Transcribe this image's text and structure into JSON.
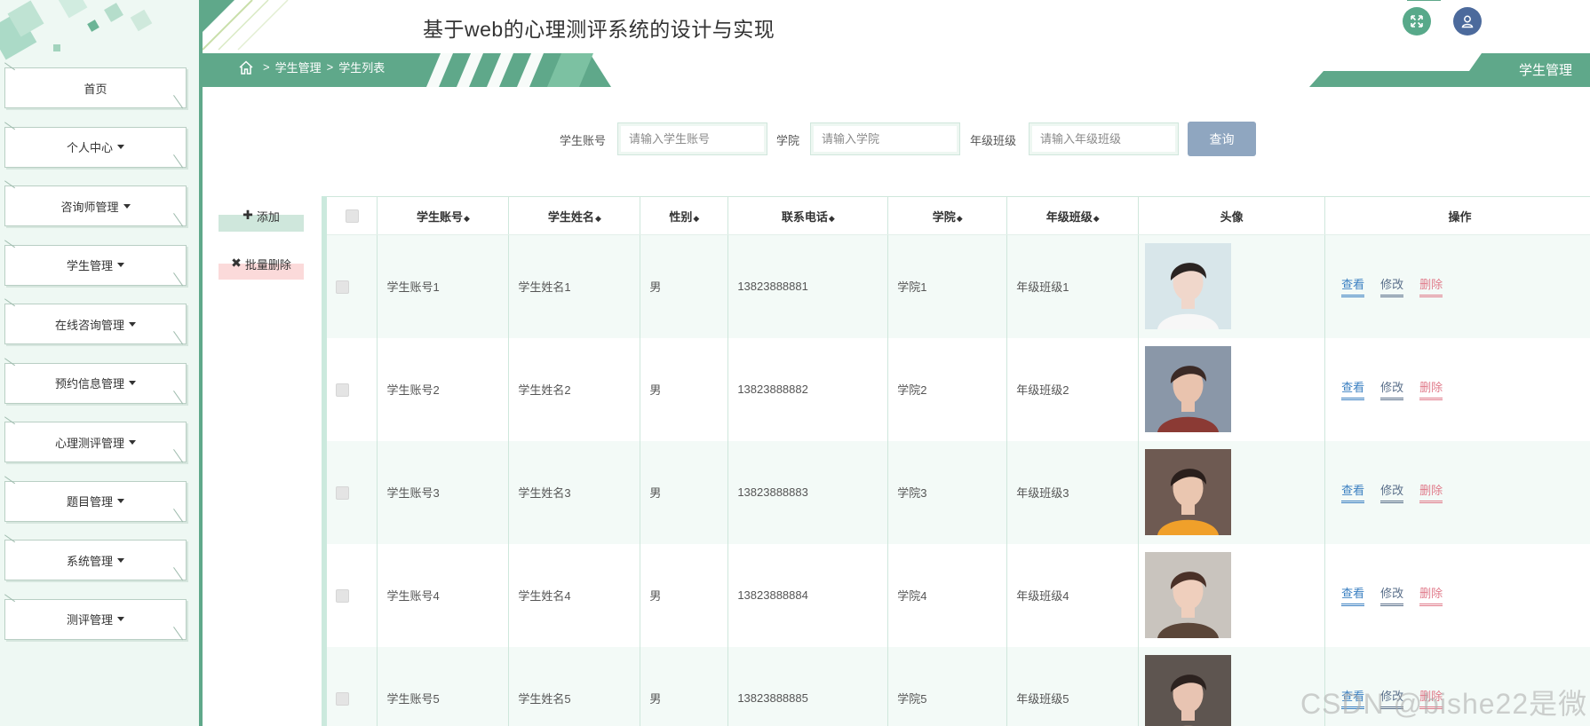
{
  "app": {
    "title": "基于web的心理测评系统的设计与实现"
  },
  "header": {
    "breadcrumb": [
      "学生管理",
      "学生列表"
    ],
    "page_tag": "学生管理",
    "icons": {
      "fullscreen": "fullscreen-icon",
      "user": "user-icon",
      "home": "home-icon"
    }
  },
  "sidebar": {
    "items": [
      {
        "label": "首页",
        "caret": false
      },
      {
        "label": "个人中心",
        "caret": true
      },
      {
        "label": "咨询师管理",
        "caret": true
      },
      {
        "label": "学生管理",
        "caret": true
      },
      {
        "label": "在线咨询管理",
        "caret": true
      },
      {
        "label": "预约信息管理",
        "caret": true
      },
      {
        "label": "心理测评管理",
        "caret": true
      },
      {
        "label": "题目管理",
        "caret": true
      },
      {
        "label": "系统管理",
        "caret": true
      },
      {
        "label": "测评管理",
        "caret": true
      }
    ]
  },
  "search": {
    "account_label": "学生账号",
    "account_placeholder": "请输入学生账号",
    "college_label": "学院",
    "college_placeholder": "请输入学院",
    "class_label": "年级班级",
    "class_placeholder": "请输入年级班级",
    "query_button": "查询"
  },
  "actions": {
    "add": "添加",
    "batch_delete": "批量删除"
  },
  "table": {
    "headers": [
      "学生账号",
      "学生姓名",
      "性别",
      "联系电话",
      "学院",
      "年级班级",
      "头像",
      "操作"
    ],
    "sortable": [
      true,
      true,
      true,
      true,
      true,
      true,
      false,
      false
    ],
    "rows": [
      {
        "account": "学生账号1",
        "name": "学生姓名1",
        "gender": "男",
        "phone": "13823888881",
        "college": "学院1",
        "class": "年级班级1"
      },
      {
        "account": "学生账号2",
        "name": "学生姓名2",
        "gender": "男",
        "phone": "13823888882",
        "college": "学院2",
        "class": "年级班级2"
      },
      {
        "account": "学生账号3",
        "name": "学生姓名3",
        "gender": "男",
        "phone": "13823888883",
        "college": "学院3",
        "class": "年级班级3"
      },
      {
        "account": "学生账号4",
        "name": "学生姓名4",
        "gender": "男",
        "phone": "13823888884",
        "college": "学院4",
        "class": "年级班级4"
      },
      {
        "account": "学生账号5",
        "name": "学生姓名5",
        "gender": "男",
        "phone": "13823888885",
        "college": "学院5",
        "class": "年级班级5"
      }
    ],
    "row_actions": {
      "view": "查看",
      "edit": "修改",
      "delete": "删除"
    }
  },
  "watermark": "CSDN @bishe22是微",
  "colors": {
    "accent": "#5fa88a",
    "sidebar_bg": "#eef8f3",
    "query_button": "#8fa6c0",
    "view": "#3a7fc1",
    "delete": "#e07a8a"
  }
}
